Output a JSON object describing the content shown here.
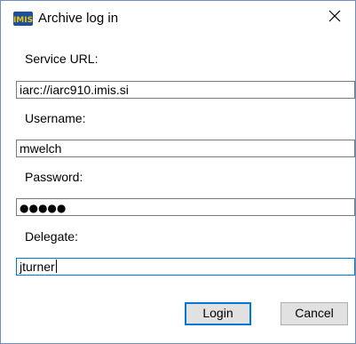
{
  "window": {
    "title": "Archive log in",
    "icon": "imis-logo-icon",
    "logo_text": "IMIS",
    "close_glyph": "✕"
  },
  "form": {
    "service_url": {
      "label": "Service URL:",
      "value": "iarc://iarc910.imis.si"
    },
    "username": {
      "label": "Username:",
      "value": "mwelch"
    },
    "password": {
      "label": "Password:",
      "masked_value": "●●●●●"
    },
    "delegate": {
      "label": "Delegate:",
      "value": "jturner"
    }
  },
  "buttons": {
    "login_label": "Login",
    "cancel_label": "Cancel"
  },
  "colors": {
    "window_border": "#6f8fb8",
    "focus_accent": "#0078d7",
    "button_face": "#e1e1e1"
  }
}
